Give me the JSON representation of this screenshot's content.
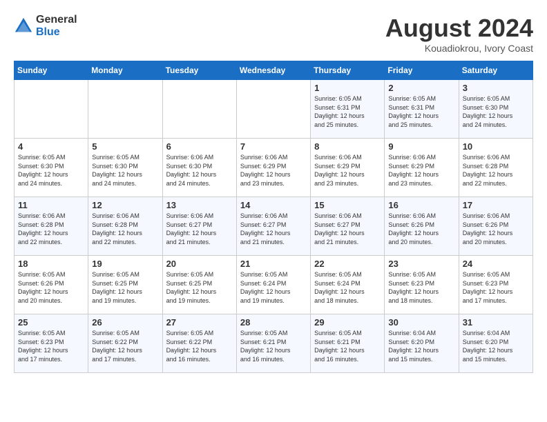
{
  "header": {
    "logo_general": "General",
    "logo_blue": "Blue",
    "title": "August 2024",
    "location": "Kouadiokrou, Ivory Coast"
  },
  "weekdays": [
    "Sunday",
    "Monday",
    "Tuesday",
    "Wednesday",
    "Thursday",
    "Friday",
    "Saturday"
  ],
  "weeks": [
    [
      {
        "day": "",
        "info": ""
      },
      {
        "day": "",
        "info": ""
      },
      {
        "day": "",
        "info": ""
      },
      {
        "day": "",
        "info": ""
      },
      {
        "day": "1",
        "info": "Sunrise: 6:05 AM\nSunset: 6:31 PM\nDaylight: 12 hours\nand 25 minutes."
      },
      {
        "day": "2",
        "info": "Sunrise: 6:05 AM\nSunset: 6:31 PM\nDaylight: 12 hours\nand 25 minutes."
      },
      {
        "day": "3",
        "info": "Sunrise: 6:05 AM\nSunset: 6:30 PM\nDaylight: 12 hours\nand 24 minutes."
      }
    ],
    [
      {
        "day": "4",
        "info": "Sunrise: 6:05 AM\nSunset: 6:30 PM\nDaylight: 12 hours\nand 24 minutes."
      },
      {
        "day": "5",
        "info": "Sunrise: 6:05 AM\nSunset: 6:30 PM\nDaylight: 12 hours\nand 24 minutes."
      },
      {
        "day": "6",
        "info": "Sunrise: 6:06 AM\nSunset: 6:30 PM\nDaylight: 12 hours\nand 24 minutes."
      },
      {
        "day": "7",
        "info": "Sunrise: 6:06 AM\nSunset: 6:29 PM\nDaylight: 12 hours\nand 23 minutes."
      },
      {
        "day": "8",
        "info": "Sunrise: 6:06 AM\nSunset: 6:29 PM\nDaylight: 12 hours\nand 23 minutes."
      },
      {
        "day": "9",
        "info": "Sunrise: 6:06 AM\nSunset: 6:29 PM\nDaylight: 12 hours\nand 23 minutes."
      },
      {
        "day": "10",
        "info": "Sunrise: 6:06 AM\nSunset: 6:28 PM\nDaylight: 12 hours\nand 22 minutes."
      }
    ],
    [
      {
        "day": "11",
        "info": "Sunrise: 6:06 AM\nSunset: 6:28 PM\nDaylight: 12 hours\nand 22 minutes."
      },
      {
        "day": "12",
        "info": "Sunrise: 6:06 AM\nSunset: 6:28 PM\nDaylight: 12 hours\nand 22 minutes."
      },
      {
        "day": "13",
        "info": "Sunrise: 6:06 AM\nSunset: 6:27 PM\nDaylight: 12 hours\nand 21 minutes."
      },
      {
        "day": "14",
        "info": "Sunrise: 6:06 AM\nSunset: 6:27 PM\nDaylight: 12 hours\nand 21 minutes."
      },
      {
        "day": "15",
        "info": "Sunrise: 6:06 AM\nSunset: 6:27 PM\nDaylight: 12 hours\nand 21 minutes."
      },
      {
        "day": "16",
        "info": "Sunrise: 6:06 AM\nSunset: 6:26 PM\nDaylight: 12 hours\nand 20 minutes."
      },
      {
        "day": "17",
        "info": "Sunrise: 6:06 AM\nSunset: 6:26 PM\nDaylight: 12 hours\nand 20 minutes."
      }
    ],
    [
      {
        "day": "18",
        "info": "Sunrise: 6:05 AM\nSunset: 6:26 PM\nDaylight: 12 hours\nand 20 minutes."
      },
      {
        "day": "19",
        "info": "Sunrise: 6:05 AM\nSunset: 6:25 PM\nDaylight: 12 hours\nand 19 minutes."
      },
      {
        "day": "20",
        "info": "Sunrise: 6:05 AM\nSunset: 6:25 PM\nDaylight: 12 hours\nand 19 minutes."
      },
      {
        "day": "21",
        "info": "Sunrise: 6:05 AM\nSunset: 6:24 PM\nDaylight: 12 hours\nand 19 minutes."
      },
      {
        "day": "22",
        "info": "Sunrise: 6:05 AM\nSunset: 6:24 PM\nDaylight: 12 hours\nand 18 minutes."
      },
      {
        "day": "23",
        "info": "Sunrise: 6:05 AM\nSunset: 6:23 PM\nDaylight: 12 hours\nand 18 minutes."
      },
      {
        "day": "24",
        "info": "Sunrise: 6:05 AM\nSunset: 6:23 PM\nDaylight: 12 hours\nand 17 minutes."
      }
    ],
    [
      {
        "day": "25",
        "info": "Sunrise: 6:05 AM\nSunset: 6:23 PM\nDaylight: 12 hours\nand 17 minutes."
      },
      {
        "day": "26",
        "info": "Sunrise: 6:05 AM\nSunset: 6:22 PM\nDaylight: 12 hours\nand 17 minutes."
      },
      {
        "day": "27",
        "info": "Sunrise: 6:05 AM\nSunset: 6:22 PM\nDaylight: 12 hours\nand 16 minutes."
      },
      {
        "day": "28",
        "info": "Sunrise: 6:05 AM\nSunset: 6:21 PM\nDaylight: 12 hours\nand 16 minutes."
      },
      {
        "day": "29",
        "info": "Sunrise: 6:05 AM\nSunset: 6:21 PM\nDaylight: 12 hours\nand 16 minutes."
      },
      {
        "day": "30",
        "info": "Sunrise: 6:04 AM\nSunset: 6:20 PM\nDaylight: 12 hours\nand 15 minutes."
      },
      {
        "day": "31",
        "info": "Sunrise: 6:04 AM\nSunset: 6:20 PM\nDaylight: 12 hours\nand 15 minutes."
      }
    ]
  ]
}
